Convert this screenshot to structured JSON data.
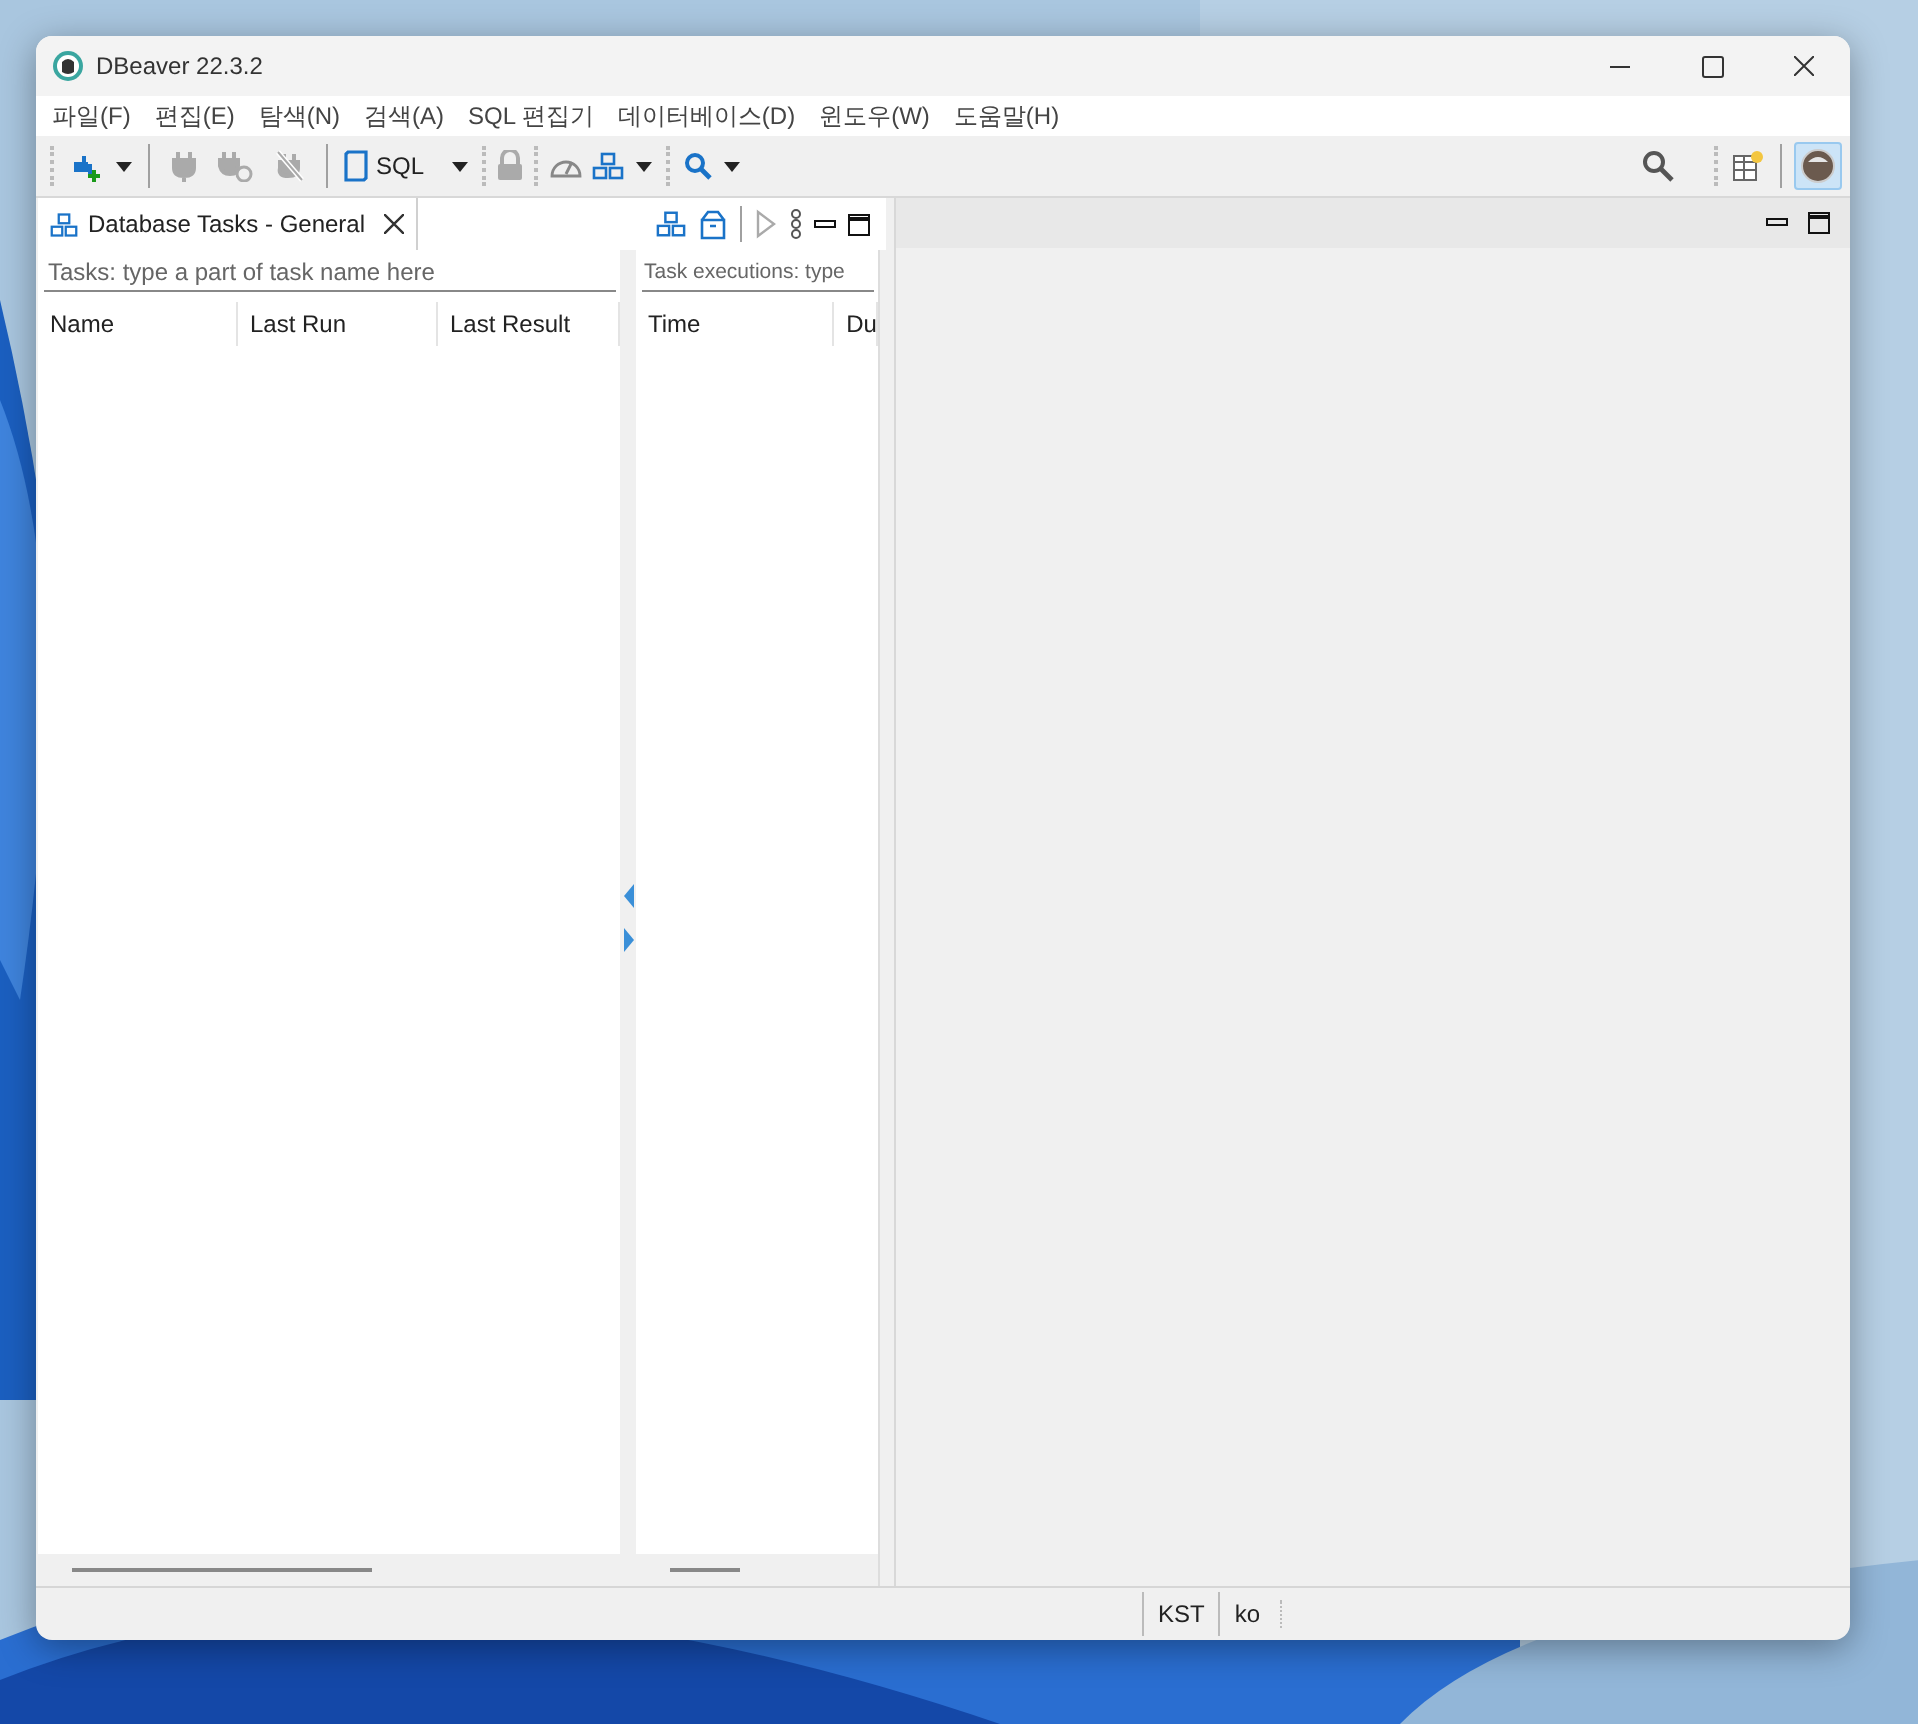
{
  "window": {
    "title": "DBeaver 22.3.2"
  },
  "menu": [
    "파일(F)",
    "편집(E)",
    "탐색(N)",
    "검색(A)",
    "SQL 편집기",
    "데이터베이스(D)",
    "윈도우(W)",
    "도움말(H)"
  ],
  "toolbar": {
    "sql_button": "SQL"
  },
  "tasks_view": {
    "tab": {
      "label": "Database Tasks - General",
      "selected": true
    },
    "filter": {
      "placeholder": "Tasks: type a part of task name here"
    },
    "columns": [
      "Name",
      "Last Run",
      "Last Result"
    ]
  },
  "executions_view": {
    "filter": {
      "placeholder": "Task executions: type"
    },
    "columns": [
      "Time",
      "Du"
    ]
  },
  "status_bar": {
    "timezone": "KST",
    "locale": "ko"
  }
}
